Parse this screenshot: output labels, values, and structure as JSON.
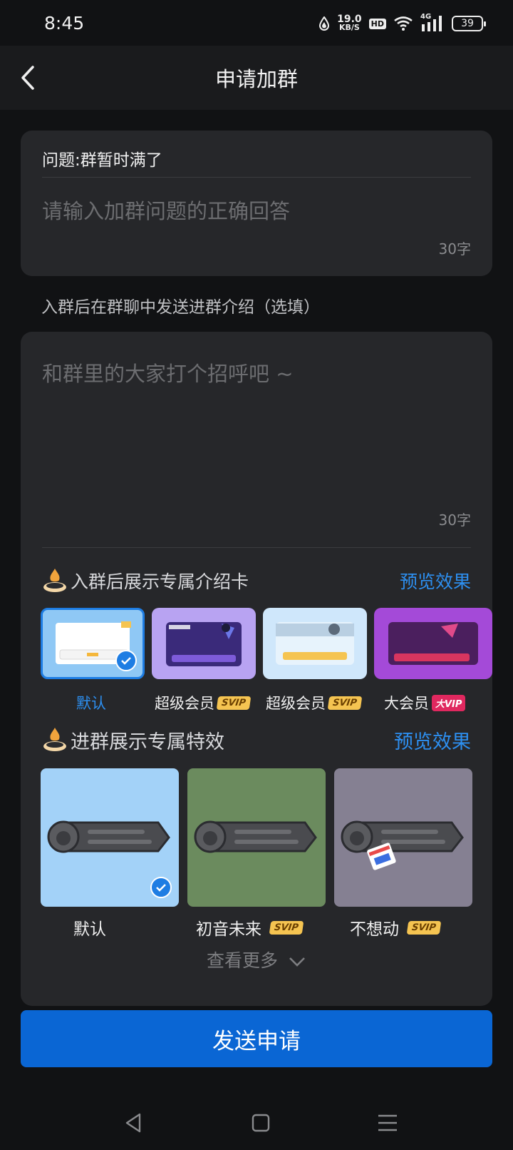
{
  "status_bar": {
    "time": "8:45",
    "net_speed_value": "19.0",
    "net_speed_unit": "KB/S",
    "hd": "HD",
    "network": "4G",
    "battery": "39"
  },
  "nav": {
    "title": "申请加群",
    "back_icon": "chevron-left-icon"
  },
  "question": {
    "title": "问题:群暂时满了",
    "placeholder": "请输入加群问题的正确回答",
    "counter": "30字"
  },
  "intro_label": "入群后在群聊中发送进群介绍（选填）",
  "intro": {
    "placeholder": "和群里的大家打个招呼吧 ~",
    "counter": "30字"
  },
  "intro_card_section": {
    "title": "入群后展示专属介绍卡",
    "preview": "预览效果",
    "items": [
      {
        "label": "默认",
        "badge": "",
        "selected": true
      },
      {
        "label": "超级会员",
        "badge": "SVIP",
        "selected": false
      },
      {
        "label": "超级会员",
        "badge": "SVIP",
        "selected": false
      },
      {
        "label": "大会员",
        "badge": "大VIP",
        "selected": false
      }
    ]
  },
  "effects_section": {
    "title": "进群展示专属特效",
    "preview": "预览效果",
    "items": [
      {
        "label": "默认",
        "badge": "",
        "selected": true,
        "color": "#a3d2f8"
      },
      {
        "label": "初音未来",
        "badge": "SVIP",
        "selected": false,
        "color": "#6b8b5e"
      },
      {
        "label": "不想动",
        "badge": "SVIP",
        "selected": false,
        "color": "#858092"
      }
    ],
    "see_more": "查看更多"
  },
  "send_button": "发送申请",
  "colors": {
    "accent": "#0a66d4",
    "link": "#2d8ff0",
    "background": "#111214",
    "card": "#26272a"
  }
}
